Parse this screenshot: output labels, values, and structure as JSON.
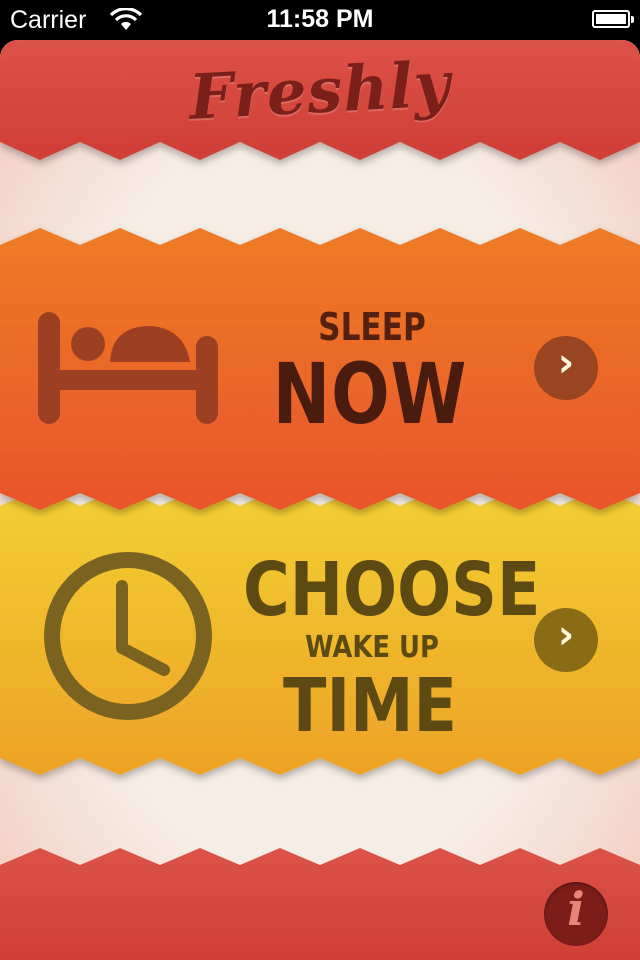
{
  "status_bar": {
    "carrier": "Carrier",
    "time": "11:58 PM",
    "wifi_icon": "wifi-icon",
    "battery_icon": "battery-icon"
  },
  "header": {
    "logo_text": "Freshly"
  },
  "sleep_now": {
    "label_small": "SLEEP",
    "label_big": "NOW",
    "icon": "bed-icon",
    "arrow": "›"
  },
  "choose_wake": {
    "label_big_top": "CHOOSE",
    "label_small": "WAKE UP",
    "label_big_bottom": "TIME",
    "icon": "clock-icon",
    "arrow": "›"
  },
  "footer": {
    "info_label": "i"
  },
  "colors": {
    "header_red": "#d8493e",
    "cream": "#f4ece4",
    "orange": "#ea6a25",
    "yellow": "#f0bd2e",
    "brown_dark": "#4a1c10",
    "olive_dark": "#5d4a12"
  }
}
